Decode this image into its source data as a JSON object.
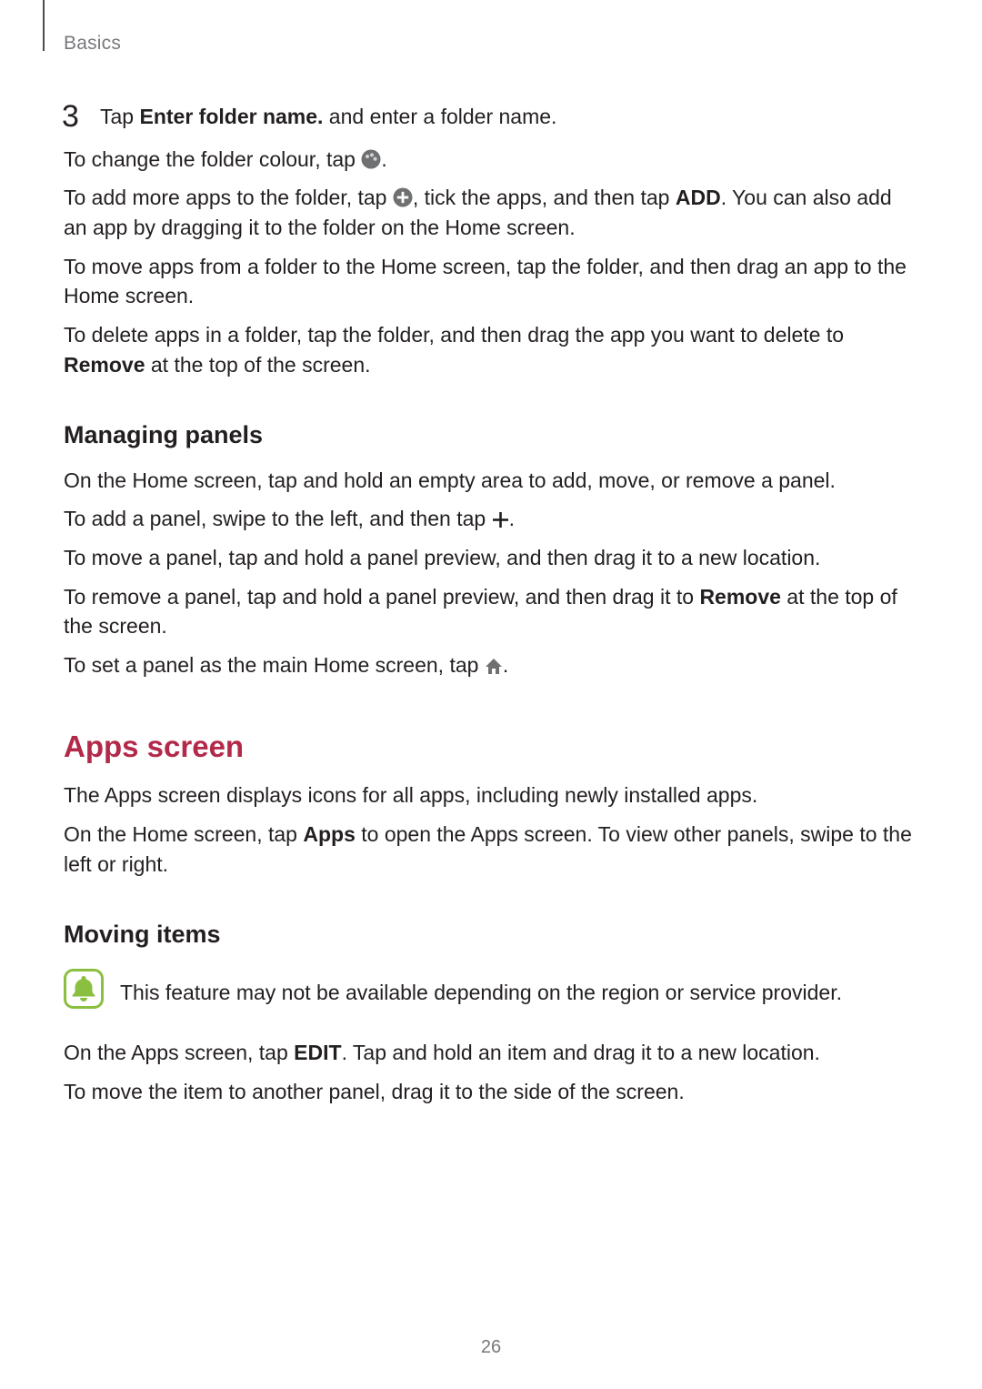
{
  "header": {
    "section": "Basics"
  },
  "step3": {
    "number": "3",
    "line1a": "Tap ",
    "line1b": "Enter folder name.",
    "line1c": " and enter a folder name.",
    "line2a": "To change the folder colour, tap ",
    "line2b": ".",
    "line3a": "To add more apps to the folder, tap ",
    "line3b": ", tick the apps, and then tap ",
    "line3c": "ADD",
    "line3d": ". You can also add an app by dragging it to the folder on the Home screen."
  },
  "para_move_from_folder": "To move apps from a folder to the Home screen, tap the folder, and then drag an app to the Home screen.",
  "para_delete_apps_a": "To delete apps in a folder, tap the folder, and then drag the app you want to delete to ",
  "para_delete_apps_b": "Remove",
  "para_delete_apps_c": " at the top of the screen.",
  "managing_panels": {
    "heading": "Managing panels",
    "p1": "On the Home screen, tap and hold an empty area to add, move, or remove a panel.",
    "p2a": "To add a panel, swipe to the left, and then tap ",
    "p2b": ".",
    "p3": "To move a panel, tap and hold a panel preview, and then drag it to a new location.",
    "p4a": "To remove a panel, tap and hold a panel preview, and then drag it to ",
    "p4b": "Remove",
    "p4c": " at the top of the screen.",
    "p5a": "To set a panel as the main Home screen, tap ",
    "p5b": "."
  },
  "apps_screen": {
    "heading": "Apps screen",
    "p1": "The Apps screen displays icons for all apps, including newly installed apps.",
    "p2a": "On the Home screen, tap ",
    "p2b": "Apps",
    "p2c": " to open the Apps screen. To view other panels, swipe to the left or right."
  },
  "moving_items": {
    "heading": "Moving items",
    "note": "This feature may not be available depending on the region or service provider.",
    "p1a": "On the Apps screen, tap ",
    "p1b": "EDIT",
    "p1c": ". Tap and hold an item and drag it to a new location.",
    "p2": "To move the item to another panel, drag it to the side of the screen."
  },
  "page_number": "26"
}
